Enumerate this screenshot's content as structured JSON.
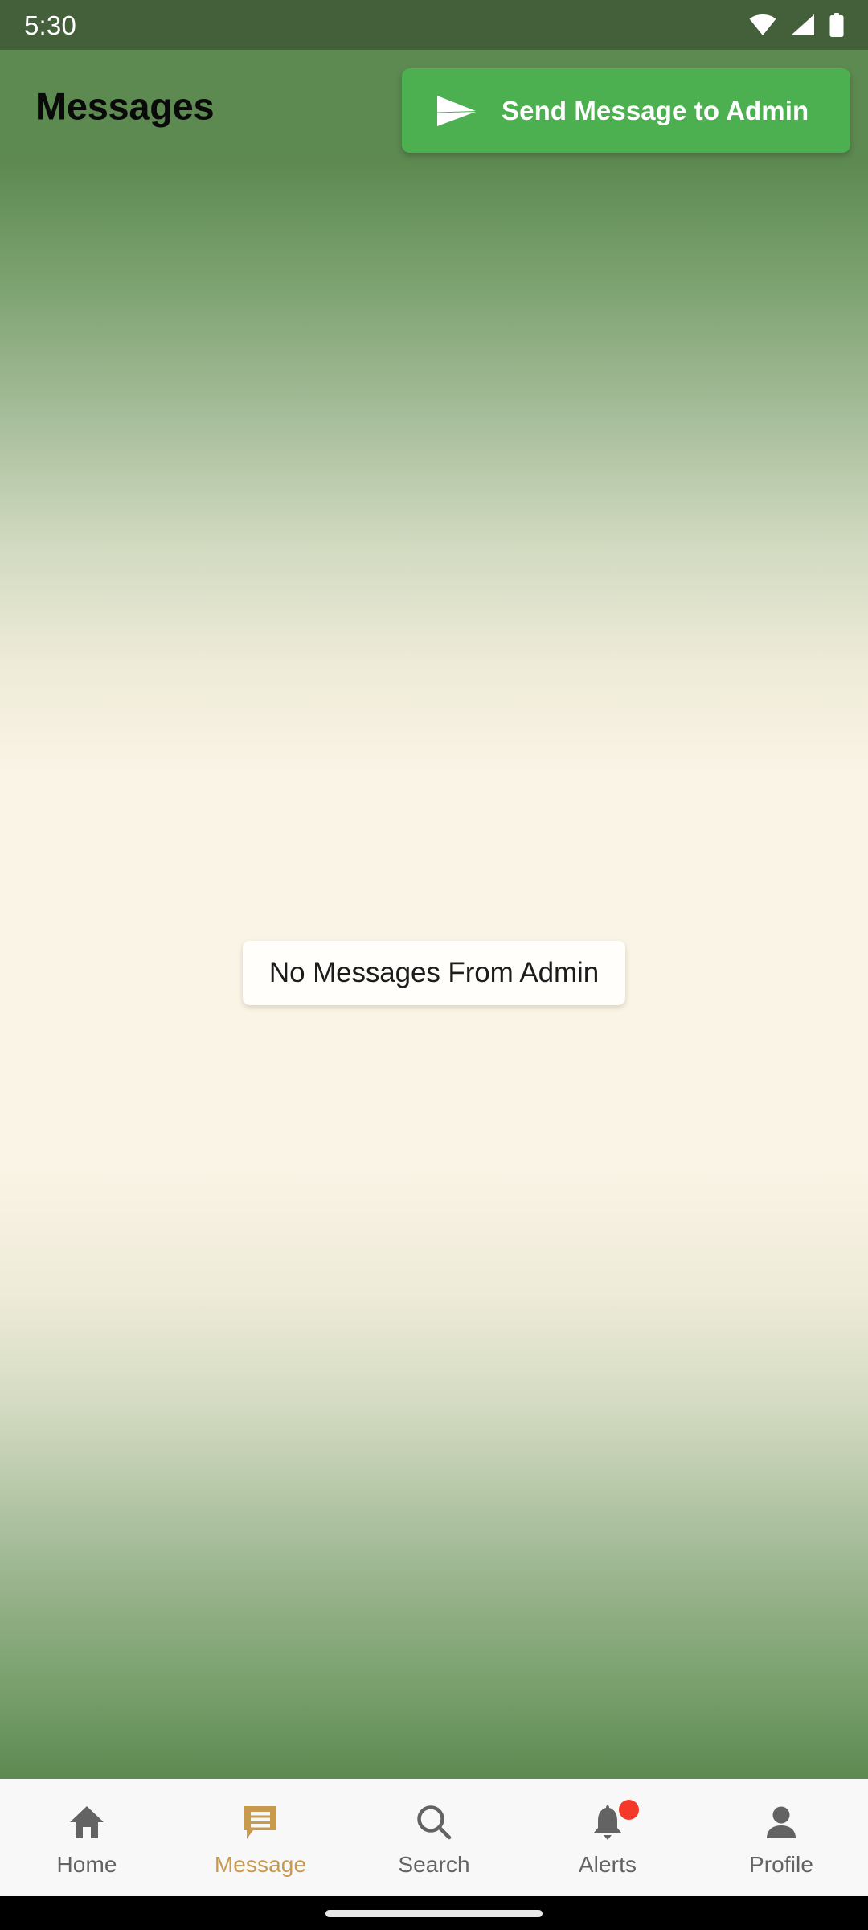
{
  "status_bar": {
    "time": "5:30",
    "icons": [
      "wifi-icon",
      "cellular-signal-icon",
      "battery-icon"
    ],
    "background_color": "#44603A",
    "text_color": "#FFFFFF"
  },
  "header": {
    "title": "Messages",
    "background_color": "#5D8A51",
    "title_color": "#0A0A0A",
    "action_button": {
      "label": "Send Message to Admin",
      "icon": "send-icon",
      "background_color": "#4CAF50",
      "text_color": "#FFFFFF"
    }
  },
  "main": {
    "empty_state": {
      "text": "No Messages From Admin",
      "card_color": "#FFFEFB",
      "text_color": "#1C1C1C"
    },
    "background_gradient": {
      "top_color": "#5D8A51",
      "middle_color": "#FAF4E6",
      "bottom_color": "#5D8A51"
    }
  },
  "bottom_nav": {
    "background_color": "#F8F8F8",
    "active_color": "#C79A4E",
    "inactive_color": "#636363",
    "badge_color": "#F4392B",
    "items": [
      {
        "label": "Home",
        "icon": "home-icon",
        "active": false,
        "badge": false
      },
      {
        "label": "Message",
        "icon": "message-icon",
        "active": true,
        "badge": false
      },
      {
        "label": "Search",
        "icon": "search-icon",
        "active": false,
        "badge": false
      },
      {
        "label": "Alerts",
        "icon": "bell-icon",
        "active": false,
        "badge": true
      },
      {
        "label": "Profile",
        "icon": "person-icon",
        "active": false,
        "badge": false
      }
    ]
  },
  "gesture_bar": {
    "background_color": "#000000",
    "indicator_color": "#E8E8E8"
  }
}
